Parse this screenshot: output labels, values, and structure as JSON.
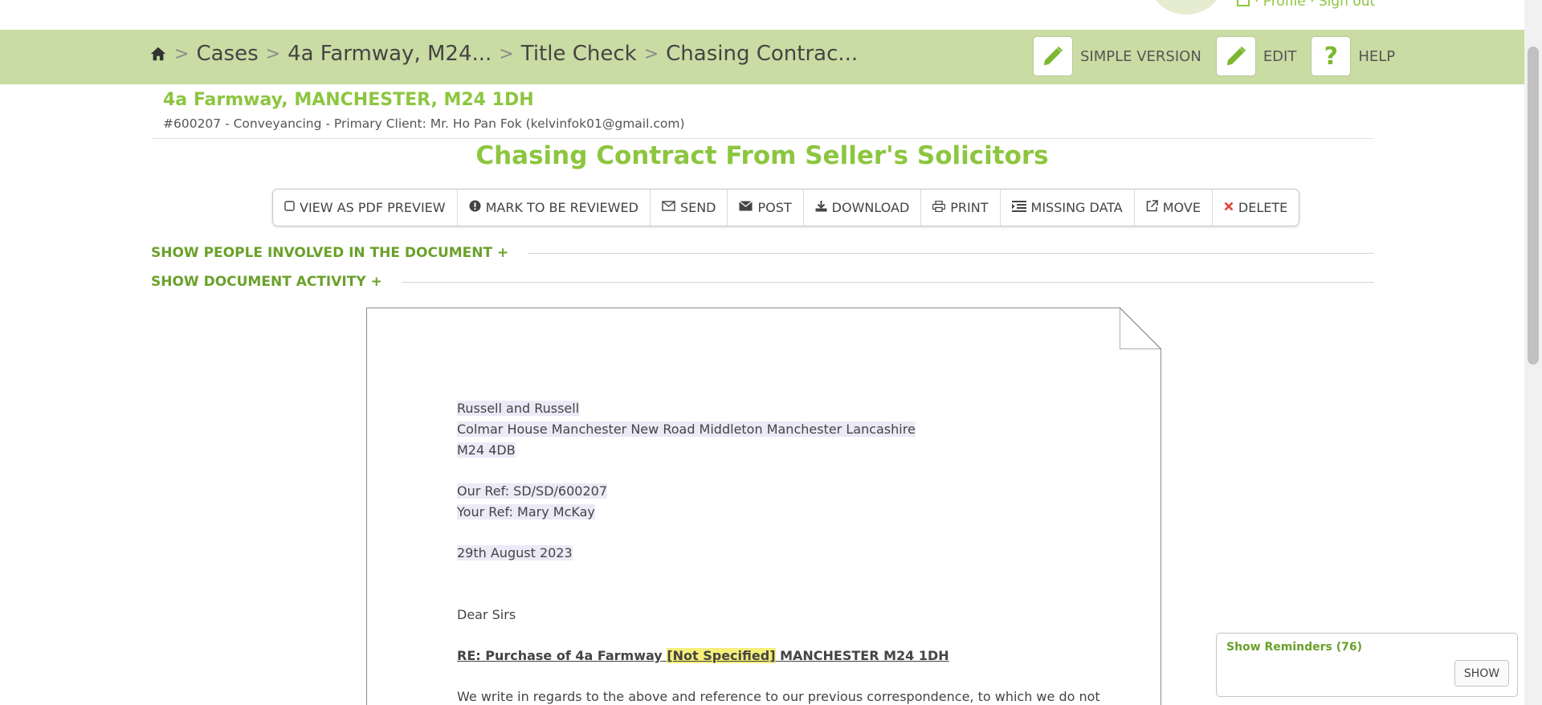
{
  "top": {
    "links": "· Profile · Sign out"
  },
  "breadcrumb": {
    "items": [
      "Cases",
      "4a Farmway, M24...",
      "Title Check",
      "Chasing Contrac..."
    ],
    "separator": ">"
  },
  "nav_actions": {
    "simple_version": "SIMPLE VERSION",
    "edit": "EDIT",
    "help": "HELP",
    "help_glyph": "?"
  },
  "case": {
    "title": "4a Farmway, MANCHESTER, M24 1DH",
    "subtitle": "#600207 - Conveyancing - Primary Client: Mr. Ho Pan Fok (kelvinfok01@gmail.com)"
  },
  "document": {
    "title": "Chasing Contract From Seller's Solicitors"
  },
  "toolbar": {
    "view_pdf": "VIEW AS PDF PREVIEW",
    "mark_review": "MARK TO BE REVIEWED",
    "send": "SEND",
    "post": "POST",
    "download": "DOWNLOAD",
    "print": "PRINT",
    "missing_data": "MISSING DATA",
    "move": "MOVE",
    "delete": "DELETE"
  },
  "sections": {
    "people": "SHOW PEOPLE INVOLVED IN THE DOCUMENT +",
    "activity": "SHOW DOCUMENT ACTIVITY +"
  },
  "letter": {
    "recipient_name": "Russell and Russell",
    "address_line": "Colmar House Manchester New Road Middleton Manchester Lancashire",
    "postcode": "M24 4DB",
    "our_ref": "Our Ref: SD/SD/600207",
    "your_ref": "Your Ref: Mary McKay",
    "date": "29th August 2023",
    "salutation": "Dear Sirs",
    "re_prefix": "RE: Purchase of 4a Farmway",
    "re_missing": "[Not Specified]",
    "re_suffix": "MANCHESTER M24 1DH",
    "body_start": "We write in regards to the above and reference to our previous correspondence, to which we do not"
  },
  "reminders": {
    "title": "Show Reminders (76)",
    "button": "SHOW"
  },
  "colors": {
    "nav_bar": "#c9dca3",
    "accent_green": "#8cc63f",
    "link_green": "#6aa12b",
    "delete_red": "#e0453a",
    "highlight_yellow": "#f5ef7a"
  },
  "icons": [
    "home-icon",
    "pencil-icon",
    "question-icon",
    "square-icon",
    "exclamation-icon",
    "envelope-open-icon",
    "envelope-icon",
    "download-icon",
    "print-icon",
    "list-icon",
    "external-link-icon",
    "close-icon"
  ]
}
